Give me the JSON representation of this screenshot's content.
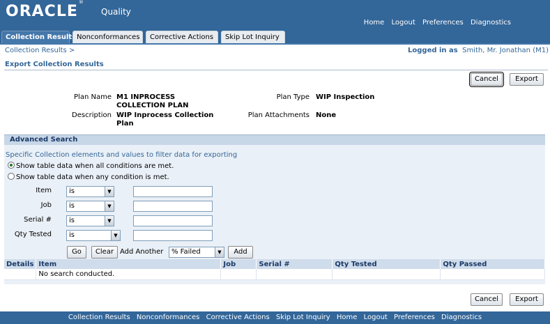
{
  "header": {
    "brand": "ORACLE",
    "brand_mark": "®",
    "app_name": "Quality",
    "global_links": [
      "Home",
      "Logout",
      "Preferences",
      "Diagnostics"
    ]
  },
  "tabs": [
    {
      "label": "Collection Results",
      "active": true
    },
    {
      "label": "Nonconformances",
      "active": false
    },
    {
      "label": "Corrective Actions",
      "active": false
    },
    {
      "label": "Skip Lot Inquiry",
      "active": false
    }
  ],
  "breadcrumb": "Collection Results  >",
  "login": {
    "prefix": "Logged in as",
    "user": "Smith, Mr. Jonathan (M1)"
  },
  "page_title": "Export Collection Results",
  "actions": {
    "cancel": "Cancel",
    "export": "Export"
  },
  "plan": {
    "plan_name_label": "Plan Name",
    "plan_name_line1": "M1 INPROCESS",
    "plan_name_line2": "COLLECTION PLAN",
    "description_label": "Description",
    "description_line1": "WIP Inprocess Collection",
    "description_line2": "Plan",
    "plan_type_label": "Plan Type",
    "plan_type": "WIP Inspection",
    "attachments_label": "Plan Attachments",
    "attachments": "None"
  },
  "advanced_search": {
    "title": "Advanced Search",
    "hint": "Specific Collection elements and values to filter data for exporting",
    "radio_all": "Show table data when all conditions are met.",
    "radio_any": "Show table data when any condition is met.",
    "selected": "all",
    "conditions": [
      {
        "label": "Item",
        "operator": "is",
        "value": ""
      },
      {
        "label": "Job",
        "operator": "is",
        "value": ""
      },
      {
        "label": "Serial #",
        "operator": "is",
        "value": ""
      },
      {
        "label": "Qty Tested",
        "operator": "is",
        "value": ""
      }
    ],
    "go": "Go",
    "clear": "Clear",
    "add_another_label": "Add Another",
    "add_another_value": "% Failed",
    "add": "Add"
  },
  "results": {
    "columns": [
      "Details",
      "Item",
      "Job",
      "Serial #",
      "Qty Tested",
      "Qty Passed"
    ],
    "empty_message": "No search conducted."
  },
  "footer_links": [
    "Collection Results",
    "Nonconformances",
    "Corrective Actions",
    "Skip Lot Inquiry",
    "Home",
    "Logout",
    "Preferences",
    "Diagnostics"
  ],
  "colors": {
    "brand_blue": "#336699",
    "panel": "#eaf0f7",
    "header_band": "#c7d7e8"
  }
}
